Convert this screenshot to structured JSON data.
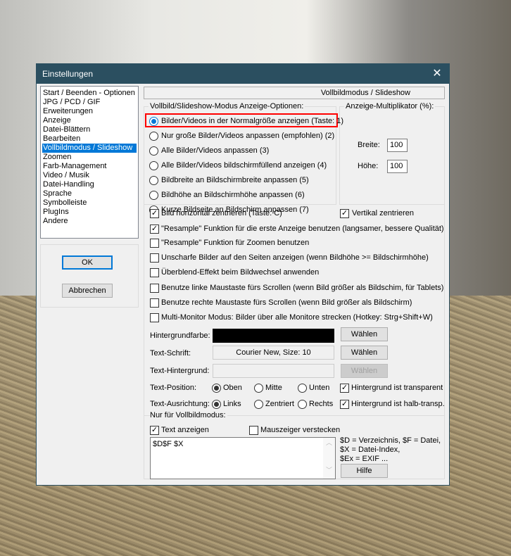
{
  "window": {
    "title": "Einstellungen",
    "close_icon": "close-icon"
  },
  "nav": {
    "items": [
      "Start / Beenden - Optionen",
      "JPG / PCD / GIF",
      "Erweiterungen",
      "Anzeige",
      "Datei-Blättern",
      "Bearbeiten",
      "Vollbildmodus / Slideshow",
      "Zoomen",
      "Farb-Management",
      "Video / Musik",
      "Datei-Handling",
      "Sprache",
      "Symbolleiste",
      "PlugIns",
      "Andere"
    ],
    "selected": "Vollbildmodus / Slideshow"
  },
  "buttons": {
    "ok": "OK",
    "cancel": "Abbrechen"
  },
  "panel": {
    "header": "Vollbildmodus / Slideshow",
    "mode_group": {
      "label": "Vollbild/Slideshow-Modus Anzeige-Optionen:",
      "options": [
        "Bilder/Videos in der Normalgröße anzeigen (Taste: 1)",
        "Nur große Bilder/Videos anpassen (empfohlen) (2)",
        "Alle Bilder/Videos anpassen (3)",
        "Alle Bilder/Videos bildschirmfüllend anzeigen (4)",
        "Bildbreite an Bildschirmbreite anpassen (5)",
        "Bildhöhe an Bildschirmhöhe anpassen (6)",
        "Kurze Bildseite an Bildschirm anpassen (7)"
      ],
      "selected_index": 0,
      "highlight_color": "#ff0000"
    },
    "multiplier": {
      "label": "Anzeige-Multiplikator (%):",
      "width_label": "Breite:",
      "width_value": "100",
      "height_label": "Höhe:",
      "height_value": "100"
    },
    "checks": [
      {
        "label": "Bild horizontal zentrieren (Taste: C)",
        "checked": true
      },
      {
        "label": "\"Resample\" Funktion für die erste Anzeige benutzen (langsamer, bessere Qualität)",
        "checked": true
      },
      {
        "label": "\"Resample\" Funktion für Zoomen benutzen",
        "checked": false
      },
      {
        "label": "Unscharfe Bilder auf den Seiten anzeigen (wenn Bildhöhe >= Bildschirmhöhe)",
        "checked": false
      },
      {
        "label": "Überblend-Effekt beim Bildwechsel anwenden",
        "checked": false
      },
      {
        "label": "Benutze linke Maustaste fürs Scrollen (wenn Bild größer als Bildschim, für Tablets)",
        "checked": false
      },
      {
        "label": "Benutze rechte Maustaste fürs Scrollen (wenn Bild größer als Bildschirm)",
        "checked": false
      },
      {
        "label": "Multi-Monitor Modus: Bilder über alle Monitore strecken (Hotkey: Strg+Shift+W)",
        "checked": false
      }
    ],
    "vertical_center": {
      "label": "Vertikal zentrieren",
      "checked": true
    },
    "bg_color": {
      "label": "Hintergrundfarbe:",
      "value": "#000000",
      "button": "Wählen"
    },
    "font": {
      "label": "Text-Schrift:",
      "value": "Courier New, Size: 10",
      "button": "Wählen"
    },
    "text_bg": {
      "label": "Text-Hintergrund:",
      "value": "",
      "button": "Wählen"
    },
    "position": {
      "label": "Text-Position:",
      "options": [
        "Oben",
        "Mitte",
        "Unten"
      ],
      "selected": "Oben"
    },
    "alignment": {
      "label": "Text-Ausrichtung:",
      "options": [
        "Links",
        "Zentriert",
        "Rechts"
      ],
      "selected": "Links"
    },
    "transparent": {
      "label": "Hintergrund ist transparent",
      "checked": true
    },
    "semi_transparent": {
      "label": "Hintergrund ist halb-transp.",
      "checked": true
    },
    "fullscreen_only": {
      "label": "Nur für Vollbildmodus:",
      "show_text": {
        "label": "Text anzeigen",
        "checked": true
      },
      "hide_cursor": {
        "label": "Mauszeiger verstecken",
        "checked": false
      },
      "text_value": "$D$F $X",
      "help_lines": [
        "$D = Verzeichnis, $F = Datei,",
        "$X = Datei-Index,",
        "$Ex = EXIF ..."
      ],
      "help_button": "Hilfe"
    }
  }
}
